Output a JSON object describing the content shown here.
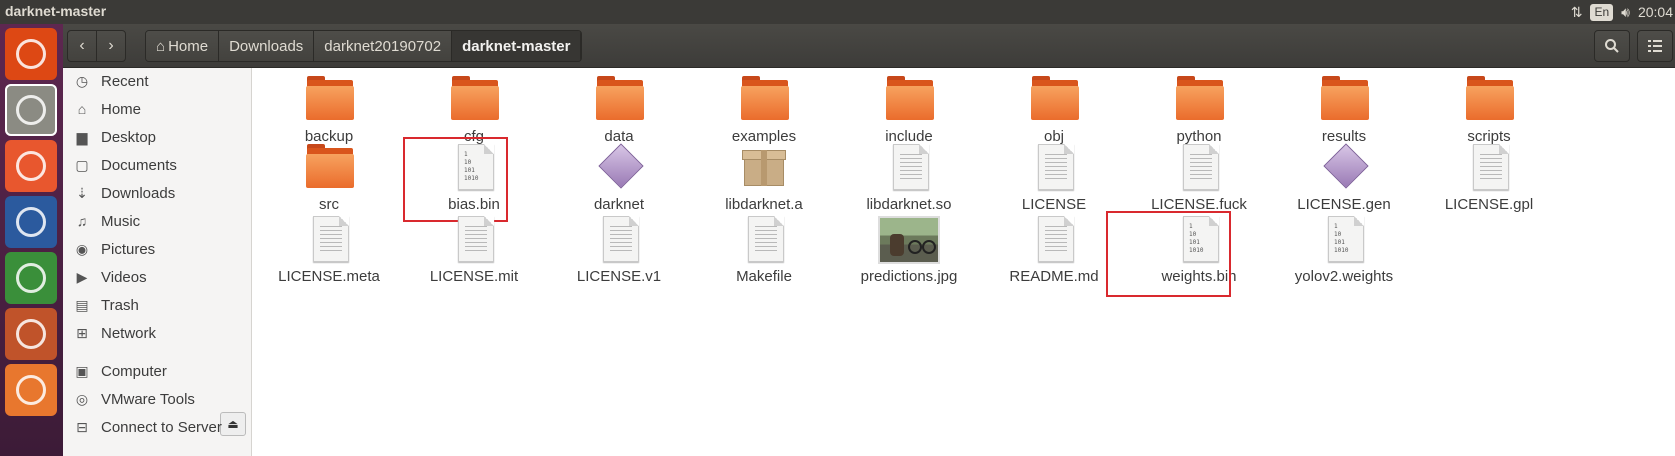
{
  "window": {
    "title": "darknet-master"
  },
  "tray": {
    "network_icon": "up-down-arrows-icon",
    "lang": "En",
    "volume_icon": "speaker-icon",
    "time": "20:04"
  },
  "launcher": [
    {
      "name": "ubuntu-dash-icon",
      "color": "#dd4814"
    },
    {
      "name": "files-icon",
      "color": "#8b8b83"
    },
    {
      "name": "firefox-icon",
      "color": "#e8572e"
    },
    {
      "name": "writer-icon",
      "color": "#2b5a9e"
    },
    {
      "name": "calc-icon",
      "color": "#3a8f3a"
    },
    {
      "name": "impress-icon",
      "color": "#c0532a"
    },
    {
      "name": "software-center-icon",
      "color": "#e8772e"
    }
  ],
  "header": {
    "back_icon": "‹",
    "forward_icon": "›",
    "breadcrumbs": [
      "Home",
      "Downloads",
      "darknet20190702",
      "darknet-master"
    ],
    "search_icon": "search-icon",
    "menu_icon": "list-icon"
  },
  "sidebar": {
    "items": [
      {
        "label": "Recent",
        "icon": "clock-icon"
      },
      {
        "label": "Home",
        "icon": "home-icon"
      },
      {
        "label": "Desktop",
        "icon": "folder-icon"
      },
      {
        "label": "Documents",
        "icon": "document-icon"
      },
      {
        "label": "Downloads",
        "icon": "download-icon"
      },
      {
        "label": "Music",
        "icon": "music-icon"
      },
      {
        "label": "Pictures",
        "icon": "camera-icon"
      },
      {
        "label": "Videos",
        "icon": "video-icon"
      },
      {
        "label": "Trash",
        "icon": "trash-icon"
      },
      {
        "label": "Network",
        "icon": "network-icon"
      },
      {
        "label": "Computer",
        "icon": "computer-icon"
      },
      {
        "label": "VMware Tools",
        "icon": "disc-icon"
      },
      {
        "label": "Connect to Server",
        "icon": "server-icon"
      }
    ]
  },
  "files": [
    {
      "name": "backup",
      "type": "folder"
    },
    {
      "name": "cfg",
      "type": "folder"
    },
    {
      "name": "data",
      "type": "folder"
    },
    {
      "name": "examples",
      "type": "folder"
    },
    {
      "name": "include",
      "type": "folder"
    },
    {
      "name": "obj",
      "type": "folder"
    },
    {
      "name": "python",
      "type": "folder"
    },
    {
      "name": "results",
      "type": "folder"
    },
    {
      "name": "scripts",
      "type": "folder"
    },
    {
      "name": "src",
      "type": "folder"
    },
    {
      "name": "bias.bin",
      "type": "binary"
    },
    {
      "name": "darknet",
      "type": "executable"
    },
    {
      "name": "libdarknet.a",
      "type": "archive"
    },
    {
      "name": "libdarknet.so",
      "type": "text"
    },
    {
      "name": "LICENSE",
      "type": "text"
    },
    {
      "name": "LICENSE.fuck",
      "type": "text"
    },
    {
      "name": "LICENSE.gen",
      "type": "executable"
    },
    {
      "name": "LICENSE.gpl",
      "type": "text"
    },
    {
      "name": "LICENSE.meta",
      "type": "text"
    },
    {
      "name": "LICENSE.mit",
      "type": "text"
    },
    {
      "name": "LICENSE.v1",
      "type": "text"
    },
    {
      "name": "Makefile",
      "type": "text"
    },
    {
      "name": "predictions.jpg",
      "type": "image"
    },
    {
      "name": "README.md",
      "type": "text"
    },
    {
      "name": "weights.bin",
      "type": "binary"
    },
    {
      "name": "yolov2.weights",
      "type": "binary"
    }
  ],
  "binary_glyph": [
    "1",
    "10",
    "101",
    "1010"
  ],
  "highlighted": [
    "bias.bin",
    "weights.bin"
  ],
  "colors": {
    "highlight": "#d9292e",
    "folder": "#ea6c2c",
    "launcher": "#5e2750"
  }
}
